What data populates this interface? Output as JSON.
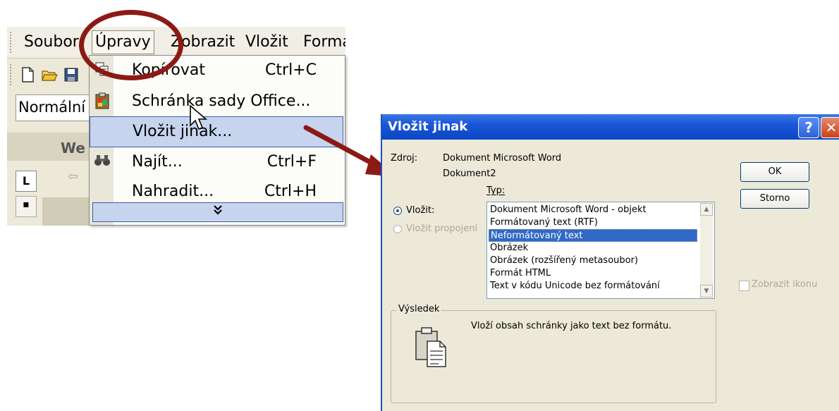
{
  "word": {
    "menu": [
      "Soubor",
      "Úpravy",
      "Zobrazit",
      "Vložit",
      "Formá"
    ],
    "style_value": "Normální",
    "tab_fragment": "We",
    "ruler_button": "L",
    "toolbar_icons": [
      "new-document-icon",
      "open-folder-icon",
      "save-icon"
    ],
    "dropdown": [
      {
        "label": "Kopírovat",
        "shortcut": "Ctrl+C",
        "icon": "copy-icon"
      },
      {
        "label": "Schránka sady Office...",
        "shortcut": "",
        "icon": "clipboard-icon"
      },
      {
        "label": "Vložit jinak...",
        "shortcut": "",
        "icon": ""
      },
      {
        "label": "Najít...",
        "shortcut": "Ctrl+F",
        "icon": "binoculars-icon"
      },
      {
        "label": "Nahradit...",
        "shortcut": "Ctrl+H",
        "icon": ""
      }
    ],
    "expand_glyph": "⌄",
    "annotation_color": "#8b1a14"
  },
  "dialog": {
    "title": "Vložit jinak",
    "help_glyph": "?",
    "close_glyph": "✕",
    "source_label": "Zdroj:",
    "source_line1": "Dokument Microsoft Word",
    "source_line2": "Dokument2",
    "type_label": "Typ:",
    "paste_radio": "Vložit:",
    "paste_link_radio": "Vložit propojení",
    "types": [
      "Dokument Microsoft Word - objekt",
      "Formátovaný text (RTF)",
      "Neformátovaný text",
      "Obrázek",
      "Obrázek (rozšířený metasoubor)",
      "Formát HTML",
      "Text v kódu Unicode bez formátování"
    ],
    "selected_type_index": 2,
    "ok_button": "OK",
    "cancel_button": "Storno",
    "show_icon_checkbox": "Zobrazit ikonu",
    "result_label": "Výsledek",
    "result_text": "Vloží obsah schránky jako text bez formátu.",
    "colors": {
      "title_bar": "#0b45c6",
      "selection": "#3169c6",
      "face": "#ece9d8"
    }
  }
}
